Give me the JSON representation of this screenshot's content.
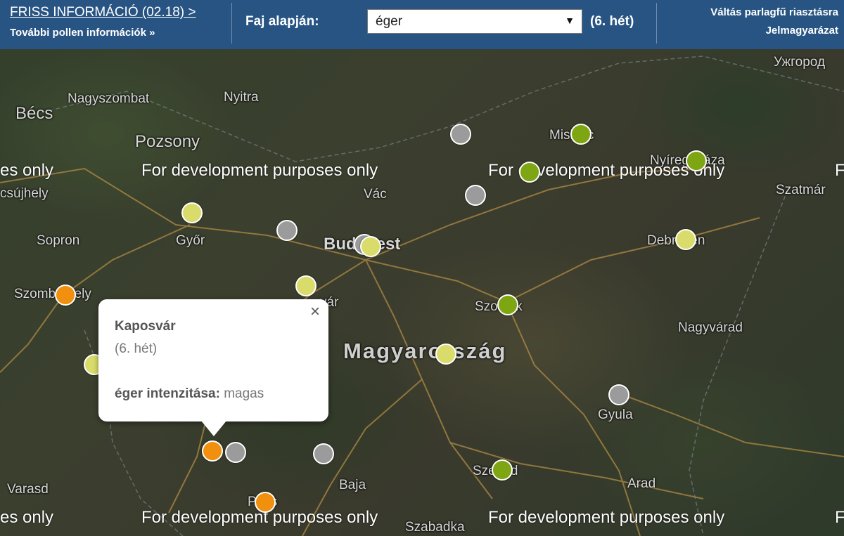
{
  "header": {
    "news_link": "FRISS INFORMÁCIÓ (02.18) >",
    "more_link": "További pollen információk »",
    "species_label": "Faj alapján:",
    "species_value": "éger",
    "week_label": "(6. hét)",
    "switch_link": "Váltás parlagfű riasztásra",
    "legend_link": "Jelmagyarázat"
  },
  "map": {
    "places": {
      "becs": "Bécs",
      "nagyszombat": "Nagyszombat",
      "nyitra": "Nyitra",
      "pozsony": "Pozsony",
      "csujhely": "csújhely",
      "sopron": "Sopron",
      "gyor": "Győr",
      "vac": "Vác",
      "budapest": "Budapest",
      "szombathely": "Szombathely",
      "varpalota": "vár",
      "szolnok": "Szolnok",
      "magyarorszag": "Magyarország",
      "nagyvarad": "Nagyvárad",
      "miskolc": "Miskolc",
      "nyiregyhaza": "Nyíregyháza",
      "debrecen": "Debrecen",
      "szatmar": "Szatmár",
      "uzhorod": "Ужгород",
      "gyula": "Gyula",
      "szeged": "Szeged",
      "baja": "Baja",
      "arad": "Arad",
      "varasd": "Varasd",
      "pecs": "Pécs",
      "szabadka": "Szabadka"
    },
    "watermark_text": "For development purposes only",
    "watermark_partial_left": "es only",
    "watermark_partial_right": "F",
    "intensity_colors": {
      "high": "#f0900e",
      "medium": "#7ea512",
      "low": "#d9dc6a",
      "none": "#9b9b9b"
    }
  },
  "popup": {
    "city": "Kaposvár",
    "week": "(6. hét)",
    "intensity_label": "éger intenzitása:",
    "intensity_value": "magas",
    "close_symbol": "×"
  }
}
